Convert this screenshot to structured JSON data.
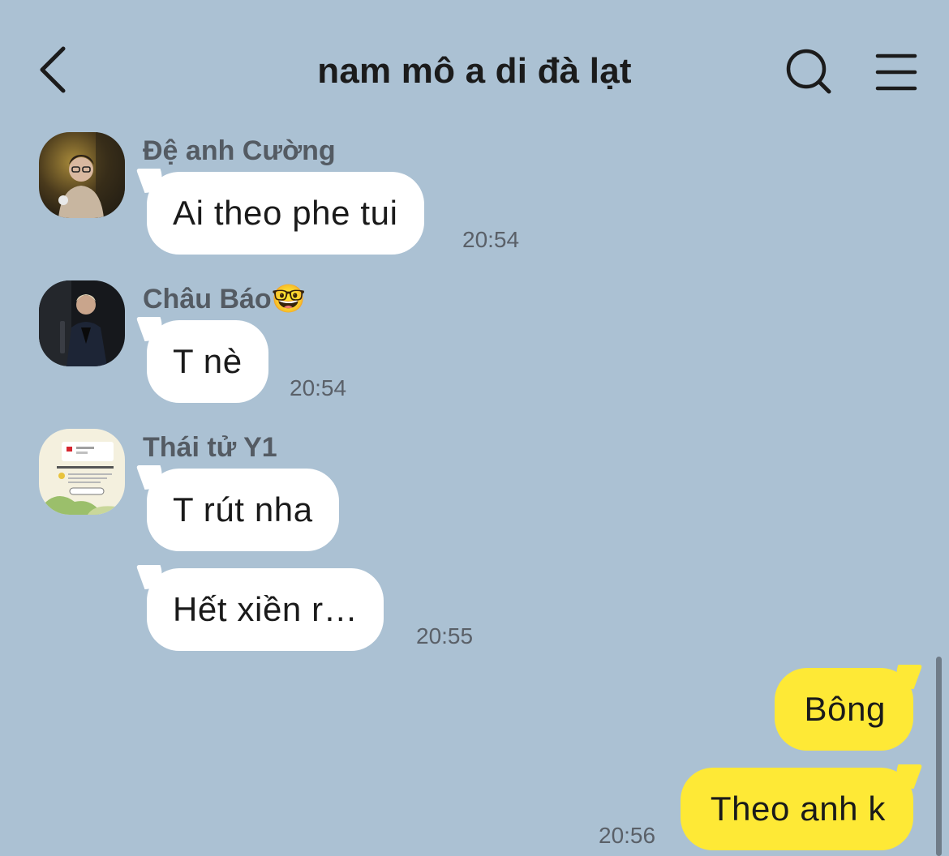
{
  "header": {
    "title": "nam mô a di đà lạt",
    "back_icon": "chevron-left-icon",
    "search_icon": "search-icon",
    "menu_icon": "hamburger-menu-icon"
  },
  "messages": [
    {
      "sender": "Đệ anh Cường",
      "text": "Ai theo phe tui",
      "time": "20:54",
      "direction": "incoming"
    },
    {
      "sender": "Châu Báo",
      "sender_emoji": "🤓",
      "text": "T nè",
      "time": "20:54",
      "direction": "incoming"
    },
    {
      "sender": "Thái tử Y1",
      "text": "T rút nha",
      "time": "",
      "direction": "incoming"
    },
    {
      "sender": "Thái tử Y1",
      "text": "Hết xiền r…",
      "time": "20:55",
      "direction": "incoming"
    },
    {
      "sender": "",
      "text": "Bông",
      "time": "",
      "direction": "outgoing"
    },
    {
      "sender": "",
      "text": "Theo anh k",
      "time": "20:56",
      "direction": "outgoing"
    }
  ],
  "colors": {
    "background": "#abc1d3",
    "incoming_bubble": "#ffffff",
    "outgoing_bubble": "#fee936",
    "sender_name": "#545b63",
    "timestamp": "#5a6068"
  }
}
